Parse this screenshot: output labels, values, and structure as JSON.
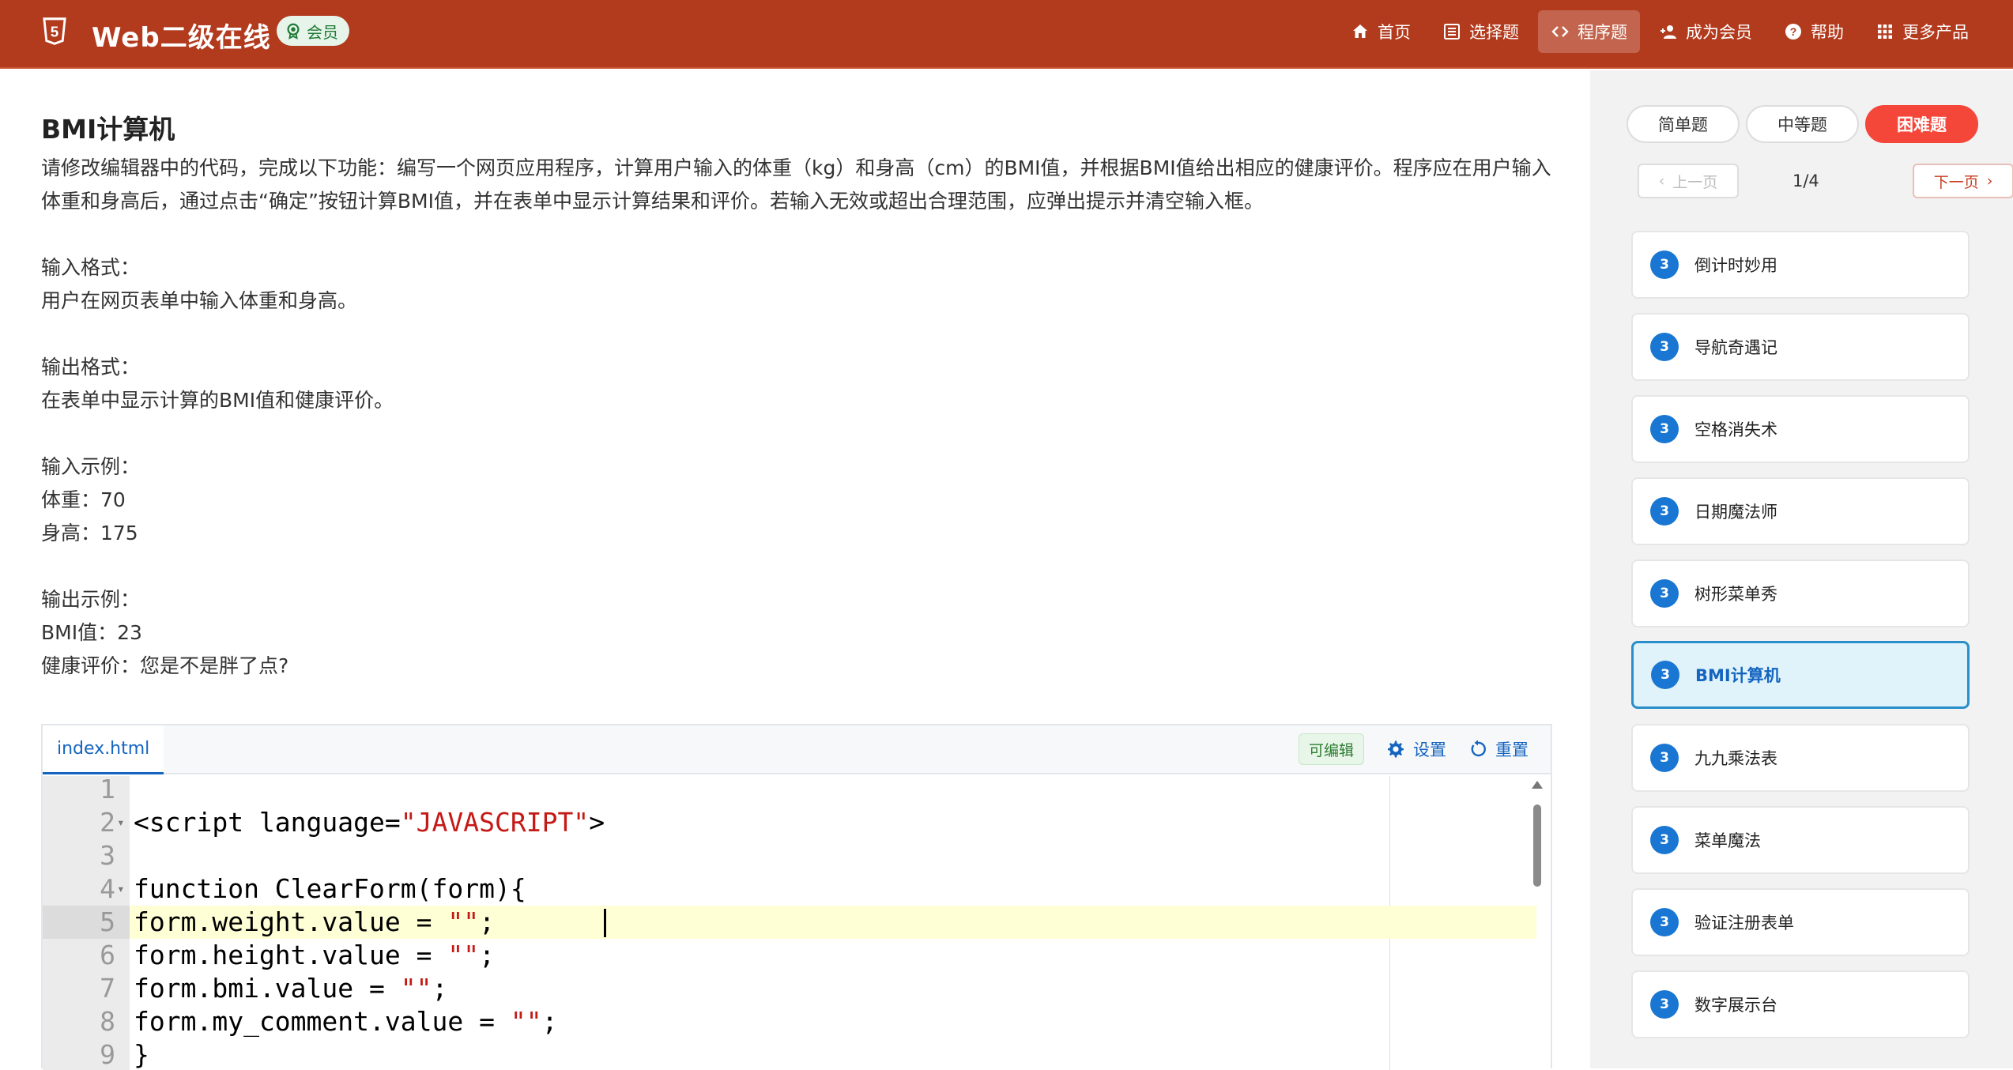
{
  "header": {
    "site_title": "Web二级在线",
    "member_badge": "会员",
    "nav": [
      {
        "label": "首页",
        "icon": "home-icon"
      },
      {
        "label": "选择题",
        "icon": "list-icon"
      },
      {
        "label": "程序题",
        "icon": "code-icon",
        "active": true
      },
      {
        "label": "成为会员",
        "icon": "add-user-icon"
      },
      {
        "label": "帮助",
        "icon": "help-icon"
      },
      {
        "label": "更多产品",
        "icon": "grid-icon"
      }
    ],
    "brand_color": "#b23a1d"
  },
  "question": {
    "title": "BMI计算机",
    "body": [
      "请修改编辑器中的代码，完成以下功能：编写一个网页应用程序，计算用户输入的体重（kg）和身高（cm）的BMI值，并根据BMI值给出相应的健康评价。程序应在用户输入体重和身高后，通过点击“确定”按钮计算BMI值，并在表单中显示计算结果和评价。若输入无效或超出合理范围，应弹出提示并清空输入框。",
      "",
      "输入格式：",
      "用户在网页表单中输入体重和身高。",
      "",
      "输出格式：",
      "在表单中显示计算的BMI值和健康评价。",
      "",
      "输入示例：",
      "体重：70",
      "身高：175",
      "",
      "输出示例：",
      "BMI值：23",
      "健康评价：您是不是胖了点?"
    ]
  },
  "editor": {
    "file_tab": "index.html",
    "editable_tag": "可编辑",
    "settings_label": "设置",
    "reset_label": "重置",
    "active_line": 5,
    "lines": [
      {
        "n": "1",
        "fold": false,
        "parts": []
      },
      {
        "n": "2",
        "fold": true,
        "parts": [
          {
            "t": "<script language="
          },
          {
            "t": "\"JAVASCRIPT\"",
            "s": true
          },
          {
            "t": ">"
          }
        ]
      },
      {
        "n": "3",
        "fold": false,
        "parts": []
      },
      {
        "n": "4",
        "fold": true,
        "parts": [
          {
            "t": "function ClearForm(form){"
          }
        ]
      },
      {
        "n": "5",
        "fold": false,
        "parts": [
          {
            "t": "form.weight.value = "
          },
          {
            "t": "\"\"",
            "s": true
          },
          {
            "t": ";"
          }
        ]
      },
      {
        "n": "6",
        "fold": false,
        "parts": [
          {
            "t": "form.height.value = "
          },
          {
            "t": "\"\"",
            "s": true
          },
          {
            "t": ";"
          }
        ]
      },
      {
        "n": "7",
        "fold": false,
        "parts": [
          {
            "t": "form.bmi.value = "
          },
          {
            "t": "\"\"",
            "s": true
          },
          {
            "t": ";"
          }
        ]
      },
      {
        "n": "8",
        "fold": false,
        "parts": [
          {
            "t": "form.my_comment.value = "
          },
          {
            "t": "\"\"",
            "s": true
          },
          {
            "t": ";"
          }
        ]
      },
      {
        "n": "9",
        "fold": false,
        "parts": [
          {
            "t": "}"
          }
        ]
      }
    ]
  },
  "sidebar": {
    "difficulty_tabs": [
      {
        "label": "简单题",
        "active": false
      },
      {
        "label": "中等题",
        "active": false
      },
      {
        "label": "困难题",
        "active": true
      }
    ],
    "pager": {
      "prev": "上一页",
      "page": "1/4",
      "next": "下一页"
    },
    "questions": [
      {
        "num": "3",
        "name": "倒计时妙用",
        "active": false
      },
      {
        "num": "3",
        "name": "导航奇遇记",
        "active": false
      },
      {
        "num": "3",
        "name": "空格消失术",
        "active": false
      },
      {
        "num": "3",
        "name": "日期魔法师",
        "active": false
      },
      {
        "num": "3",
        "name": "树形菜单秀",
        "active": false
      },
      {
        "num": "3",
        "name": "BMI计算机",
        "active": true
      },
      {
        "num": "3",
        "name": "九九乘法表",
        "active": false
      },
      {
        "num": "3",
        "name": "菜单魔法",
        "active": false
      },
      {
        "num": "3",
        "name": "验证注册表单",
        "active": false
      },
      {
        "num": "3",
        "name": "数字展示台",
        "active": false
      }
    ]
  }
}
